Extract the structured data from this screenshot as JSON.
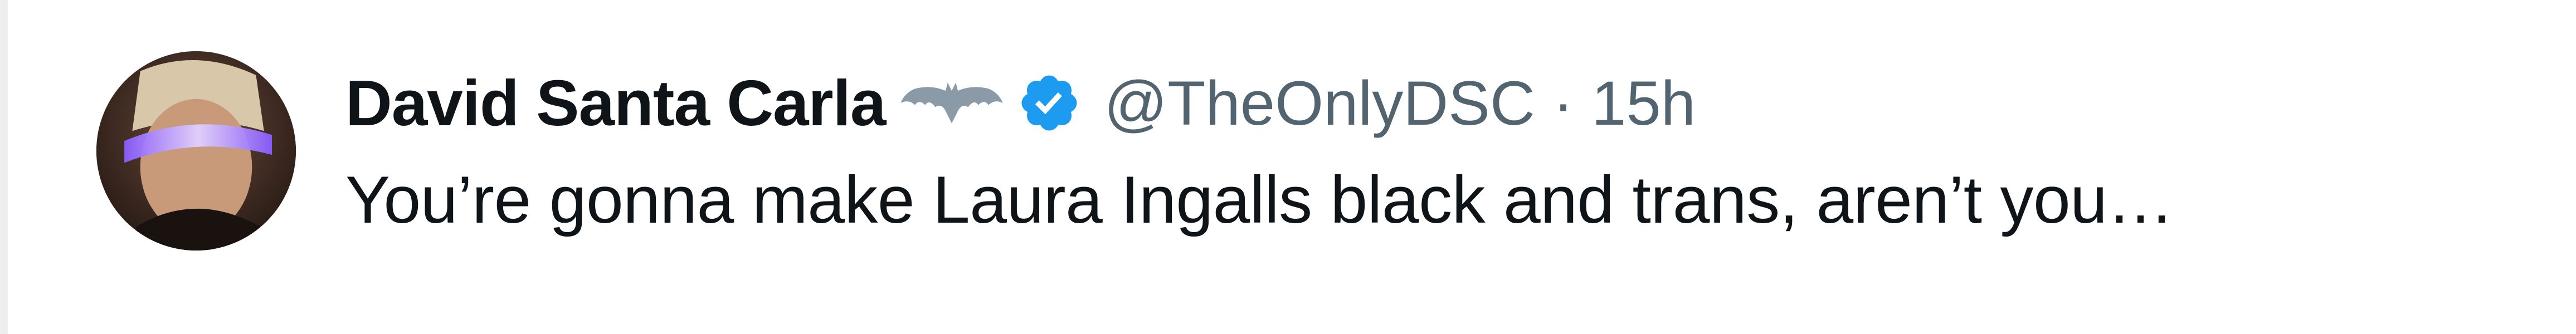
{
  "tweet": {
    "display_name": "David Santa Carla",
    "handle": "@TheOnlyDSC",
    "separator": "·",
    "timestamp": "15h",
    "text": "You’re gonna make Laura Ingalls black and trans, aren’t you…"
  },
  "icons": {
    "badge_emoji": "bat-icon",
    "verified": "verified-badge-icon"
  },
  "colors": {
    "name_text": "#0f1419",
    "secondary_text": "#536471",
    "verified_blue": "#1d9bf0",
    "background": "#ffffff"
  }
}
